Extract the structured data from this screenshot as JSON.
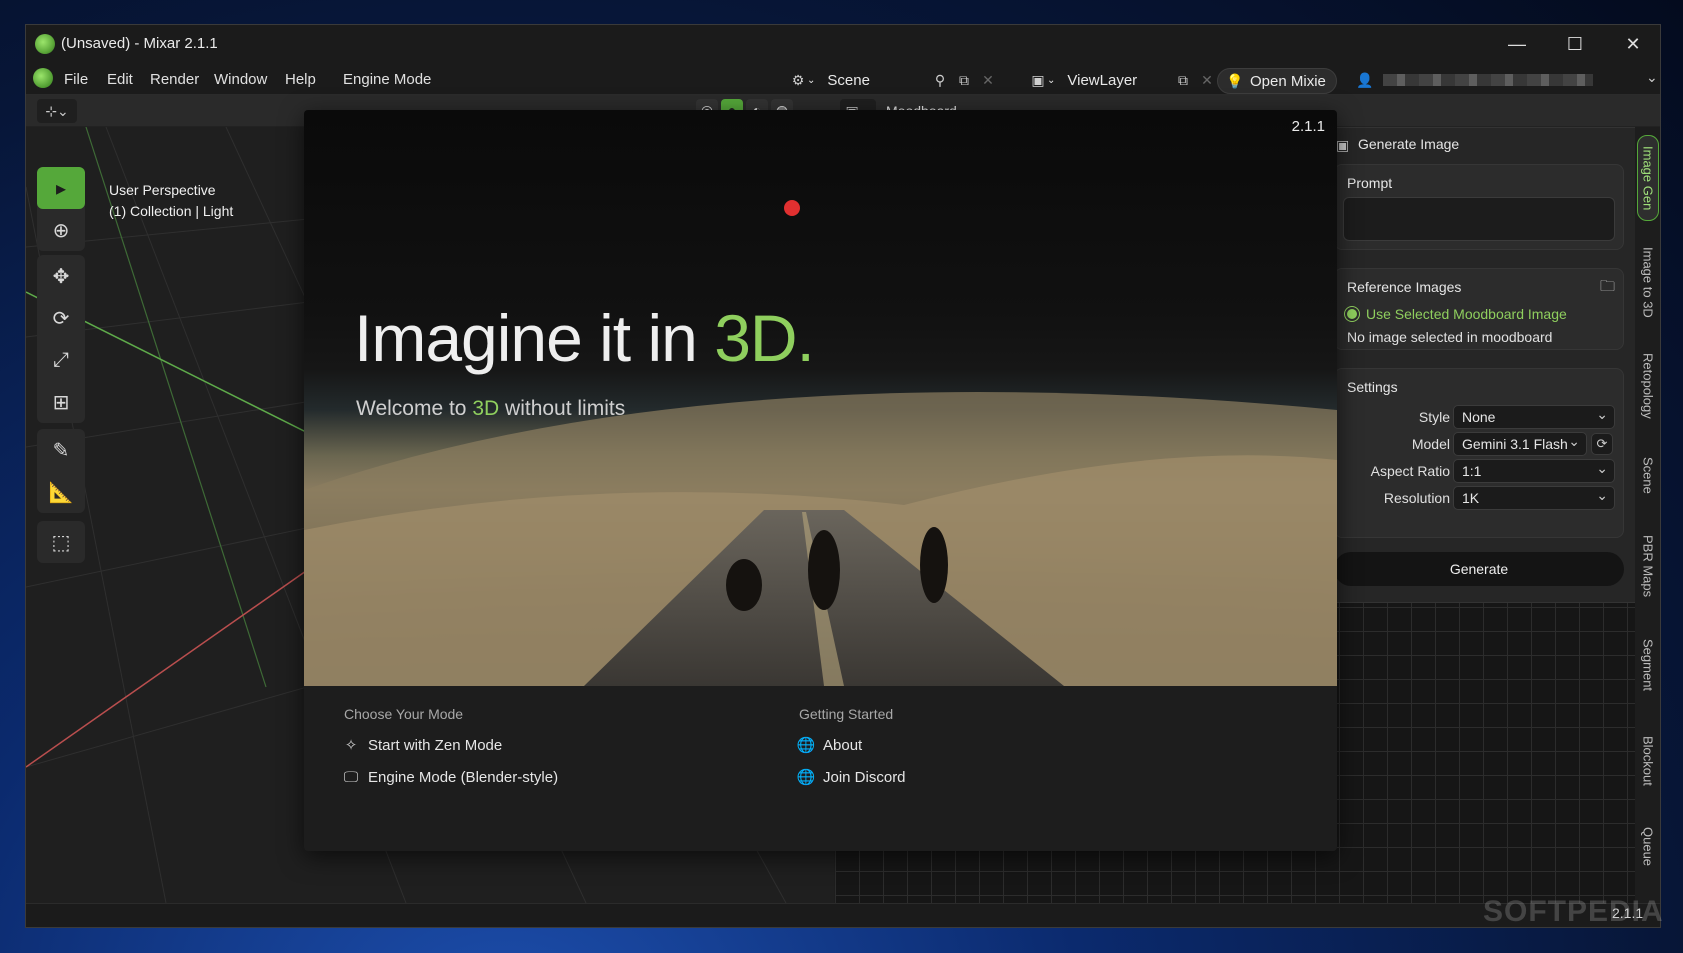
{
  "window": {
    "title": "(Unsaved) - Mixar 2.1.1",
    "controls": {
      "minimize": "—",
      "maximize": "☐",
      "close": "✕"
    }
  },
  "menubar": {
    "items": [
      "File",
      "Edit",
      "Render",
      "Window",
      "Help",
      "Engine Mode"
    ],
    "scene_label": "Scene",
    "viewlayer_label": "ViewLayer",
    "open_mixie": "Open Mixie"
  },
  "viewport": {
    "perspective": "User Perspective",
    "collection": "(1) Collection | Light"
  },
  "moodboard": {
    "title": "Moodboard"
  },
  "splash": {
    "version": "2.1.1",
    "headline_prefix": "Imagine it in ",
    "headline_accent": "3D.",
    "sub_prefix": "Welcome to ",
    "sub_accent": "3D",
    "sub_suffix": " without limits",
    "mode_heading": "Choose Your Mode",
    "mode_links": [
      "Start with Zen Mode",
      "Engine Mode (Blender-style)"
    ],
    "started_heading": "Getting Started",
    "started_links": [
      "About",
      "Join Discord"
    ]
  },
  "panel": {
    "title": "Generate Image",
    "prompt_label": "Prompt",
    "reference_label": "Reference Images",
    "use_selected": "Use Selected Moodboard Image",
    "no_image": "No image selected in moodboard",
    "settings_label": "Settings",
    "fields": [
      {
        "label": "Style",
        "value": "None"
      },
      {
        "label": "Model",
        "value": "Gemini 3.1 Flash"
      },
      {
        "label": "Aspect Ratio",
        "value": "1:1"
      },
      {
        "label": "Resolution",
        "value": "1K"
      }
    ],
    "generate": "Generate"
  },
  "vertical_tabs": [
    "Image Gen",
    "Image to 3D",
    "Retopology",
    "Scene",
    "PBR Maps",
    "Segment",
    "Blockout",
    "Queue"
  ],
  "status": {
    "version": "2.1.1"
  },
  "watermark": "SOFTPEDIA",
  "colors": {
    "accent": "#8fcf5e",
    "active_tool": "#55a83a"
  }
}
